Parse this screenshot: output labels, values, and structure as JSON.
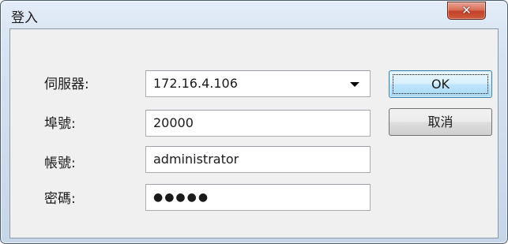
{
  "window": {
    "title": "登入",
    "close_glyph": "✕"
  },
  "form": {
    "server": {
      "label": "伺服器:",
      "value": "172.16.4.106"
    },
    "port": {
      "label": "埠號:",
      "value": "20000"
    },
    "account": {
      "label": "帳號:",
      "value": "administrator"
    },
    "password": {
      "label": "密碼:",
      "value": "●●●●●"
    }
  },
  "buttons": {
    "ok": "OK",
    "cancel": "取消"
  },
  "icons": {
    "close": "close-icon",
    "dropdown": "chevron-down-icon"
  },
  "colors": {
    "close_button": "#c2402a",
    "default_button_border": "#3c7fb1"
  }
}
